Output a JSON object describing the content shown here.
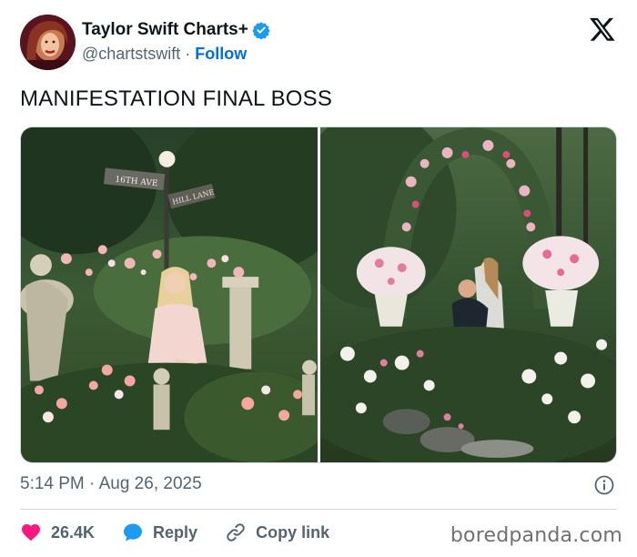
{
  "header": {
    "display_name": "Taylor Swift Charts+",
    "handle": "@chartstswift",
    "separator": "·",
    "follow_label": "Follow",
    "verified_color": "#1d9bf0"
  },
  "tweet": {
    "text": "MANIFESTATION FINAL BOSS",
    "timestamp": "5:14 PM · Aug 26, 2025"
  },
  "media": {
    "photo_1": {
      "sign_1": "16TH AVE",
      "sign_2": "HILL LANE"
    }
  },
  "actions": {
    "like_count": "26.4K",
    "reply_label": "Reply",
    "copy_link_label": "Copy link",
    "like_color": "#f91880",
    "reply_color": "#1d9bf0"
  },
  "watermark": "boredpanda.com"
}
